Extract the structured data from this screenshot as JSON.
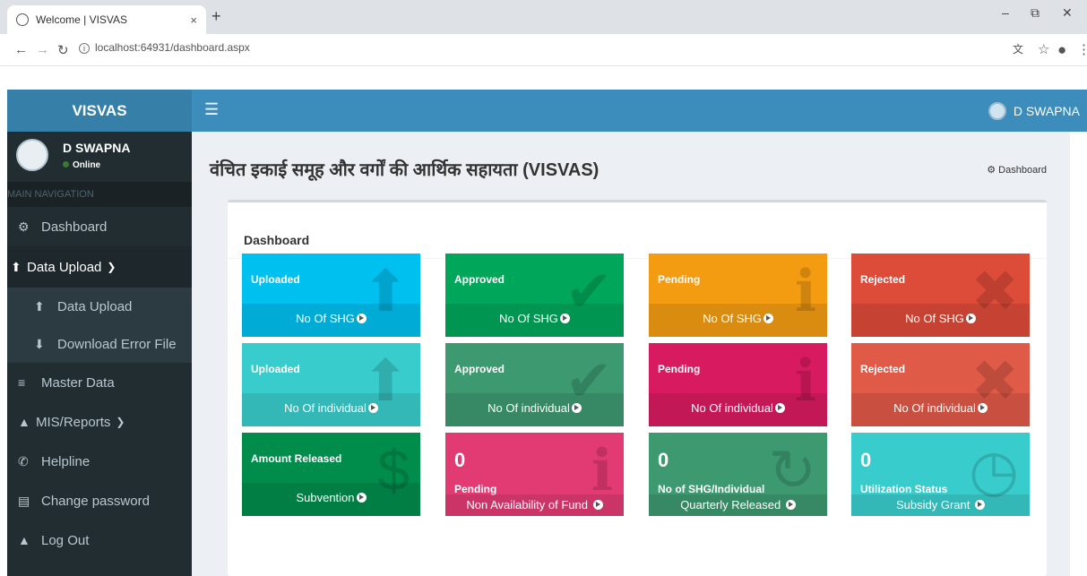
{
  "browser": {
    "tab_title": "Welcome | VISVAS",
    "tab_close": "×",
    "new_tab": "+",
    "url": "localhost:64931/dashboard.aspx"
  },
  "header": {
    "logo": "VISVAS",
    "user": "D SWAPNA"
  },
  "sidebar": {
    "user_name": "D SWAPNA",
    "status": "Online",
    "nav_header": "MAIN NAVIGATION",
    "items": [
      {
        "label": "Dashboard",
        "icon": "dashboard-icon"
      },
      {
        "label": "Data Upload",
        "icon": "upload-icon"
      },
      {
        "label": "Data Upload",
        "icon": "upload-icon"
      },
      {
        "label": "Download Error File",
        "icon": "download-icon"
      },
      {
        "label": "Master Data",
        "icon": "database-icon"
      },
      {
        "label": "MIS/Reports",
        "icon": "chart-icon"
      },
      {
        "label": "Helpline",
        "icon": "phone-icon"
      },
      {
        "label": "Change password",
        "icon": "id-card-icon"
      },
      {
        "label": "Log Out",
        "icon": "lock-icon"
      }
    ]
  },
  "content": {
    "title": "वंचित इकाई समूह और वर्गों की आर्थिक सहायता (VISVAS)",
    "breadcrumb": "Dashboard",
    "box_title": "Dashboard",
    "tiles": [
      {
        "label": "Uploaded",
        "foot": "No Of SHG",
        "color": "#00c0ef"
      },
      {
        "label": "Approved",
        "foot": "No Of SHG",
        "color": "#00a65a"
      },
      {
        "label": "Pending",
        "foot": "No Of SHG",
        "color": "#f39c12"
      },
      {
        "label": "Rejected",
        "foot": "No Of SHG",
        "color": "#dd4b39"
      },
      {
        "label": "Uploaded",
        "foot": "No Of individual",
        "color": "#39cccc"
      },
      {
        "label": "Approved",
        "foot": "No Of individual",
        "color": "#3d9970"
      },
      {
        "label": "Pending",
        "foot": "No Of individual",
        "color": "#d81b60"
      },
      {
        "label": "Rejected",
        "foot": "No Of individual",
        "color": "#e05a48"
      },
      {
        "label": "Amount Released",
        "foot": "Subvention",
        "color": "#008d4c"
      },
      {
        "value": "0",
        "label": "Pending",
        "foot": "Non Availability of Fund",
        "color": "#e23a73"
      },
      {
        "value": "0",
        "label": "No of SHG/Individual",
        "foot": "Quarterly Released",
        "color": "#3d9970"
      },
      {
        "value": "0",
        "label": "Utilization Status",
        "foot": "Subsidy Grant",
        "color": "#39cccc"
      }
    ]
  }
}
